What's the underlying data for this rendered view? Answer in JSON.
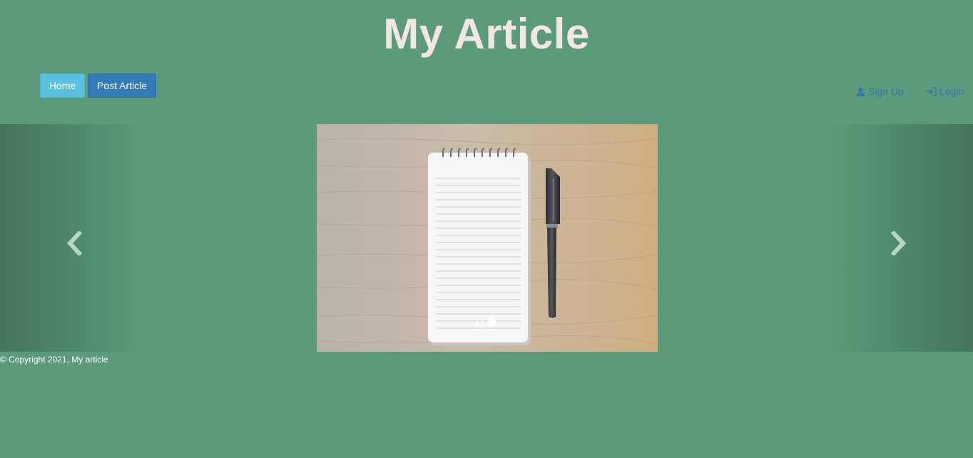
{
  "header": {
    "title": "My Article"
  },
  "nav": {
    "home_label": "Home",
    "post_label": "Post Article",
    "signup_label": "Sign Up",
    "login_label": "Login"
  },
  "carousel": {
    "image_desc": "notepad-and-pen-on-wooden-desk",
    "indicator_count": 2,
    "active_index": 1,
    "prev_icon": "chevron-left-icon",
    "next_icon": "chevron-right-icon"
  },
  "footer": {
    "copyright": "© Copyright 2021, My article"
  },
  "colors": {
    "background": "#5b9b7c",
    "title": "#f1e6e3",
    "home_button": "#5bc0de",
    "post_button": "#337ab7",
    "link": "#337ab7"
  }
}
